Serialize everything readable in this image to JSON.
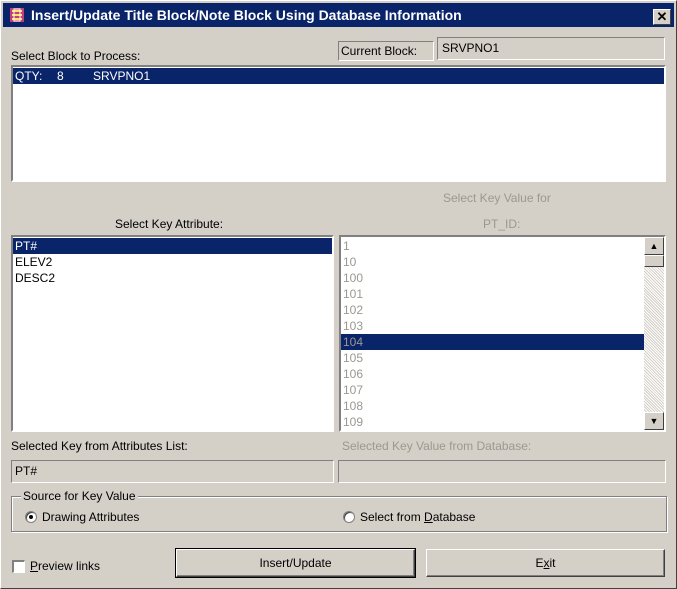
{
  "window": {
    "title": "Insert/Update Title Block/Note Block Using Database Information",
    "close_symbol": "✕",
    "app_icon": "cad-app-icon"
  },
  "block_section": {
    "label": "Select Block to Process:",
    "current_block_label": "Current Block:",
    "current_block_value": "SRVPNO1",
    "rows": [
      {
        "qty_label": "QTY:",
        "qty": "8",
        "name": "SRVPNO1",
        "selected": true
      }
    ]
  },
  "key_attribute": {
    "label": "Select Key Attribute:",
    "items": [
      "PT#",
      "ELEV2",
      "DESC2"
    ],
    "selected_index": 0
  },
  "key_value": {
    "label_line1": "Select Key Value for",
    "label_line2": "PT_ID:",
    "items": [
      "1",
      "10",
      "100",
      "101",
      "102",
      "103",
      "104",
      "105",
      "106",
      "107",
      "108",
      "109"
    ],
    "selected_index": 6
  },
  "selected_key": {
    "label": "Selected Key from Attributes List:",
    "value": "PT#"
  },
  "selected_db_key": {
    "label": "Selected Key Value from Database:",
    "value": ""
  },
  "source": {
    "legend": "Source for Key Value",
    "option_drawing": "Drawing Attributes",
    "option_database_pre": "Select from ",
    "option_database_ul": "D",
    "option_database_post": "atabase",
    "selected": "drawing"
  },
  "preview": {
    "label_ul": "P",
    "label_rest": "review links",
    "checked": false
  },
  "buttons": {
    "insert_update": "Insert/Update",
    "exit_pre": "E",
    "exit_ul": "x",
    "exit_post": "it"
  }
}
